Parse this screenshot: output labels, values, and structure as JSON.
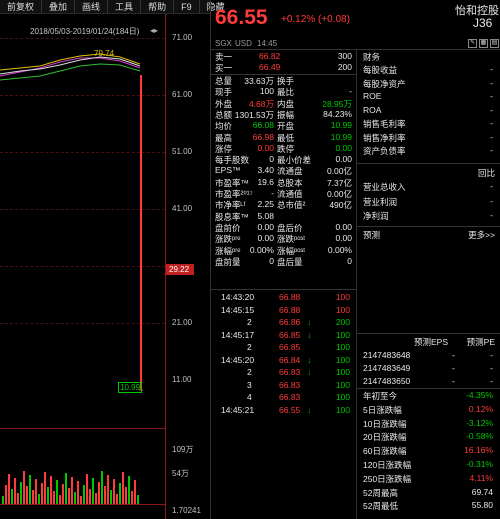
{
  "menu": [
    "前复权",
    "叠加",
    "画线",
    "工具",
    "帮助",
    "F9",
    "隐藏"
  ],
  "chart": {
    "range": "2018/05/03-2019/01/24(184日)",
    "peak_label": "79.74",
    "y_ticks": [
      "71.00",
      "61.00",
      "51.00",
      "41.00",
      "31.00",
      "21.00",
      "11.00"
    ],
    "marker_price": "29.22",
    "low_label": "10.99",
    "vol_ticks": [
      "109万",
      "54万"
    ],
    "bottom_value": "1.70241",
    "colors": {
      "up": "#ff3b3b",
      "down": "#00c800",
      "axis": "#8a1a1a"
    }
  },
  "quote": {
    "price": "66.55",
    "change": "+0.12% (+0.08)",
    "name": "怡和控股",
    "code": "J36",
    "exchange": "SGX",
    "currency": "USD",
    "time": "14:45"
  },
  "orderbook": [
    {
      "label": "卖一",
      "price": "66.82",
      "vol": "300"
    },
    {
      "label": "买一",
      "price": "66.49",
      "vol": "200"
    }
  ],
  "stats": [
    {
      "l1": "总量",
      "v1": "33.63万",
      "l2": "换手",
      "v2": "",
      "c1": "white",
      "c2": "white"
    },
    {
      "l1": "现手",
      "v1": "100",
      "l2": "最比",
      "v2": "-",
      "c1": "white",
      "c2": "white"
    },
    {
      "l1": "外盘",
      "v1": "4.68万",
      "l2": "内盘",
      "v2": "28.95万",
      "c1": "red",
      "c2": "green"
    },
    {
      "l1": "总额",
      "v1": "1301.53万",
      "l2": "振幅",
      "v2": "84.23%",
      "c1": "white",
      "c2": "white"
    },
    {
      "l1": "均价",
      "v1": "66.08",
      "l2": "开盘",
      "v2": "10.99",
      "c1": "green",
      "c2": "green"
    },
    {
      "l1": "最高",
      "v1": "66.98",
      "l2": "最低",
      "v2": "10.99",
      "c1": "red",
      "c2": "green"
    },
    {
      "l1": "涨停",
      "v1": "0.00",
      "l2": "跌停",
      "v2": "0.00",
      "c1": "red",
      "c2": "green"
    },
    {
      "l1": "每手股数",
      "v1": "0",
      "l2": "最小价差",
      "v2": "0.00",
      "c1": "white",
      "c2": "white"
    },
    {
      "l1": "EPS™",
      "v1": "3.40",
      "l2": "流通盘",
      "v2": "0.00亿",
      "c1": "white",
      "c2": "white"
    },
    {
      "l1": "市盈率™",
      "v1": "19.6",
      "l2": "总股本",
      "v2": "7.37亿",
      "c1": "white",
      "c2": "white"
    },
    {
      "l1": "市盈率²⁰¹⁷",
      "v1": "-",
      "l2": "流通值",
      "v2": "0.00亿",
      "c1": "white",
      "c2": "white"
    },
    {
      "l1": "市净率ᴸᶠ",
      "v1": "2.25",
      "l2": "总市值²",
      "v2": "490亿",
      "c1": "white",
      "c2": "white"
    },
    {
      "l1": "股息率™",
      "v1": "5.08",
      "l2": "",
      "v2": "",
      "c1": "white",
      "c2": "white"
    },
    {
      "l1": "盘前价",
      "v1": "0.00",
      "l2": "盘后价",
      "v2": "0.00",
      "c1": "white",
      "c2": "white"
    },
    {
      "l1": "涨跌ᵖʳᵉ",
      "v1": "0.00",
      "l2": "涨跌ᵖᵒˢᵗ",
      "v2": "0.00",
      "c1": "white",
      "c2": "white"
    },
    {
      "l1": "涨幅ᵖʳᵉ",
      "v1": "0.00%",
      "l2": "涨幅ᵖᵒˢᵗ",
      "v2": "0.00%",
      "c1": "white",
      "c2": "white"
    },
    {
      "l1": "盘前量",
      "v1": "0",
      "l2": "盘后量",
      "v2": "0",
      "c1": "white",
      "c2": "white"
    }
  ],
  "ticks": [
    {
      "t": "14:43:20",
      "p": "66.88",
      "a": "",
      "v": "100",
      "pc": "red",
      "vc": "red"
    },
    {
      "t": "14:45:15",
      "p": "66.88",
      "a": "",
      "v": "100",
      "pc": "red",
      "vc": "red"
    },
    {
      "t": "2",
      "p": "66.86",
      "a": "↓",
      "v": "200",
      "pc": "red",
      "vc": "green"
    },
    {
      "t": "14:45:17",
      "p": "66.85",
      "a": "↓",
      "v": "100",
      "pc": "red",
      "vc": "green"
    },
    {
      "t": "2",
      "p": "66.85",
      "a": "",
      "v": "100",
      "pc": "red",
      "vc": "green"
    },
    {
      "t": "14:45:20",
      "p": "66.84",
      "a": "↓",
      "v": "100",
      "pc": "red",
      "vc": "green"
    },
    {
      "t": "2",
      "p": "66.83",
      "a": "↓",
      "v": "100",
      "pc": "red",
      "vc": "green"
    },
    {
      "t": "3",
      "p": "66.83",
      "a": "",
      "v": "100",
      "pc": "red",
      "vc": "green"
    },
    {
      "t": "4",
      "p": "66.83",
      "a": "",
      "v": "100",
      "pc": "red",
      "vc": "green"
    },
    {
      "t": "14:45:21",
      "p": "66.55",
      "a": "↓",
      "v": "100",
      "pc": "red",
      "vc": "green"
    }
  ],
  "finance": {
    "header": "财务",
    "items": [
      "每股收益",
      "每股净资产",
      "ROE",
      "ROA",
      "销售毛利率",
      "销售净利率",
      "资产负债率"
    ],
    "vals": [
      "-",
      "-",
      "-",
      "-",
      "-",
      "-",
      "-"
    ],
    "report_label": "回比",
    "report_items": [
      "营业总收入",
      "营业利润",
      "净利润"
    ],
    "report_vals": [
      "-",
      "-",
      "-"
    ]
  },
  "forecast": {
    "header": "预测",
    "more": "更多>>",
    "col1": "预测EPS",
    "col2": "预测PE",
    "rows": [
      {
        "id": "2147483648",
        "a": "-",
        "b": "-"
      },
      {
        "id": "2147483649",
        "a": "-",
        "b": "-"
      },
      {
        "id": "2147483650",
        "a": "-",
        "b": "-"
      }
    ]
  },
  "perf": [
    {
      "l": "年初至今",
      "v": "-4.35%",
      "c": "green"
    },
    {
      "l": "5日涨跌幅",
      "v": "0.12%",
      "c": "red"
    },
    {
      "l": "10日涨跌幅",
      "v": "-3.12%",
      "c": "green"
    },
    {
      "l": "20日涨跌幅",
      "v": "-0.58%",
      "c": "green"
    },
    {
      "l": "60日涨跌幅",
      "v": "16.16%",
      "c": "red"
    },
    {
      "l": "120日涨跌幅",
      "v": "-0.31%",
      "c": "green"
    },
    {
      "l": "250日涨跌幅",
      "v": "4.11%",
      "c": "red"
    },
    {
      "l": "52周最高",
      "v": "69.74",
      "c": "white"
    },
    {
      "l": "52周最低",
      "v": "55.80",
      "c": "white"
    }
  ]
}
